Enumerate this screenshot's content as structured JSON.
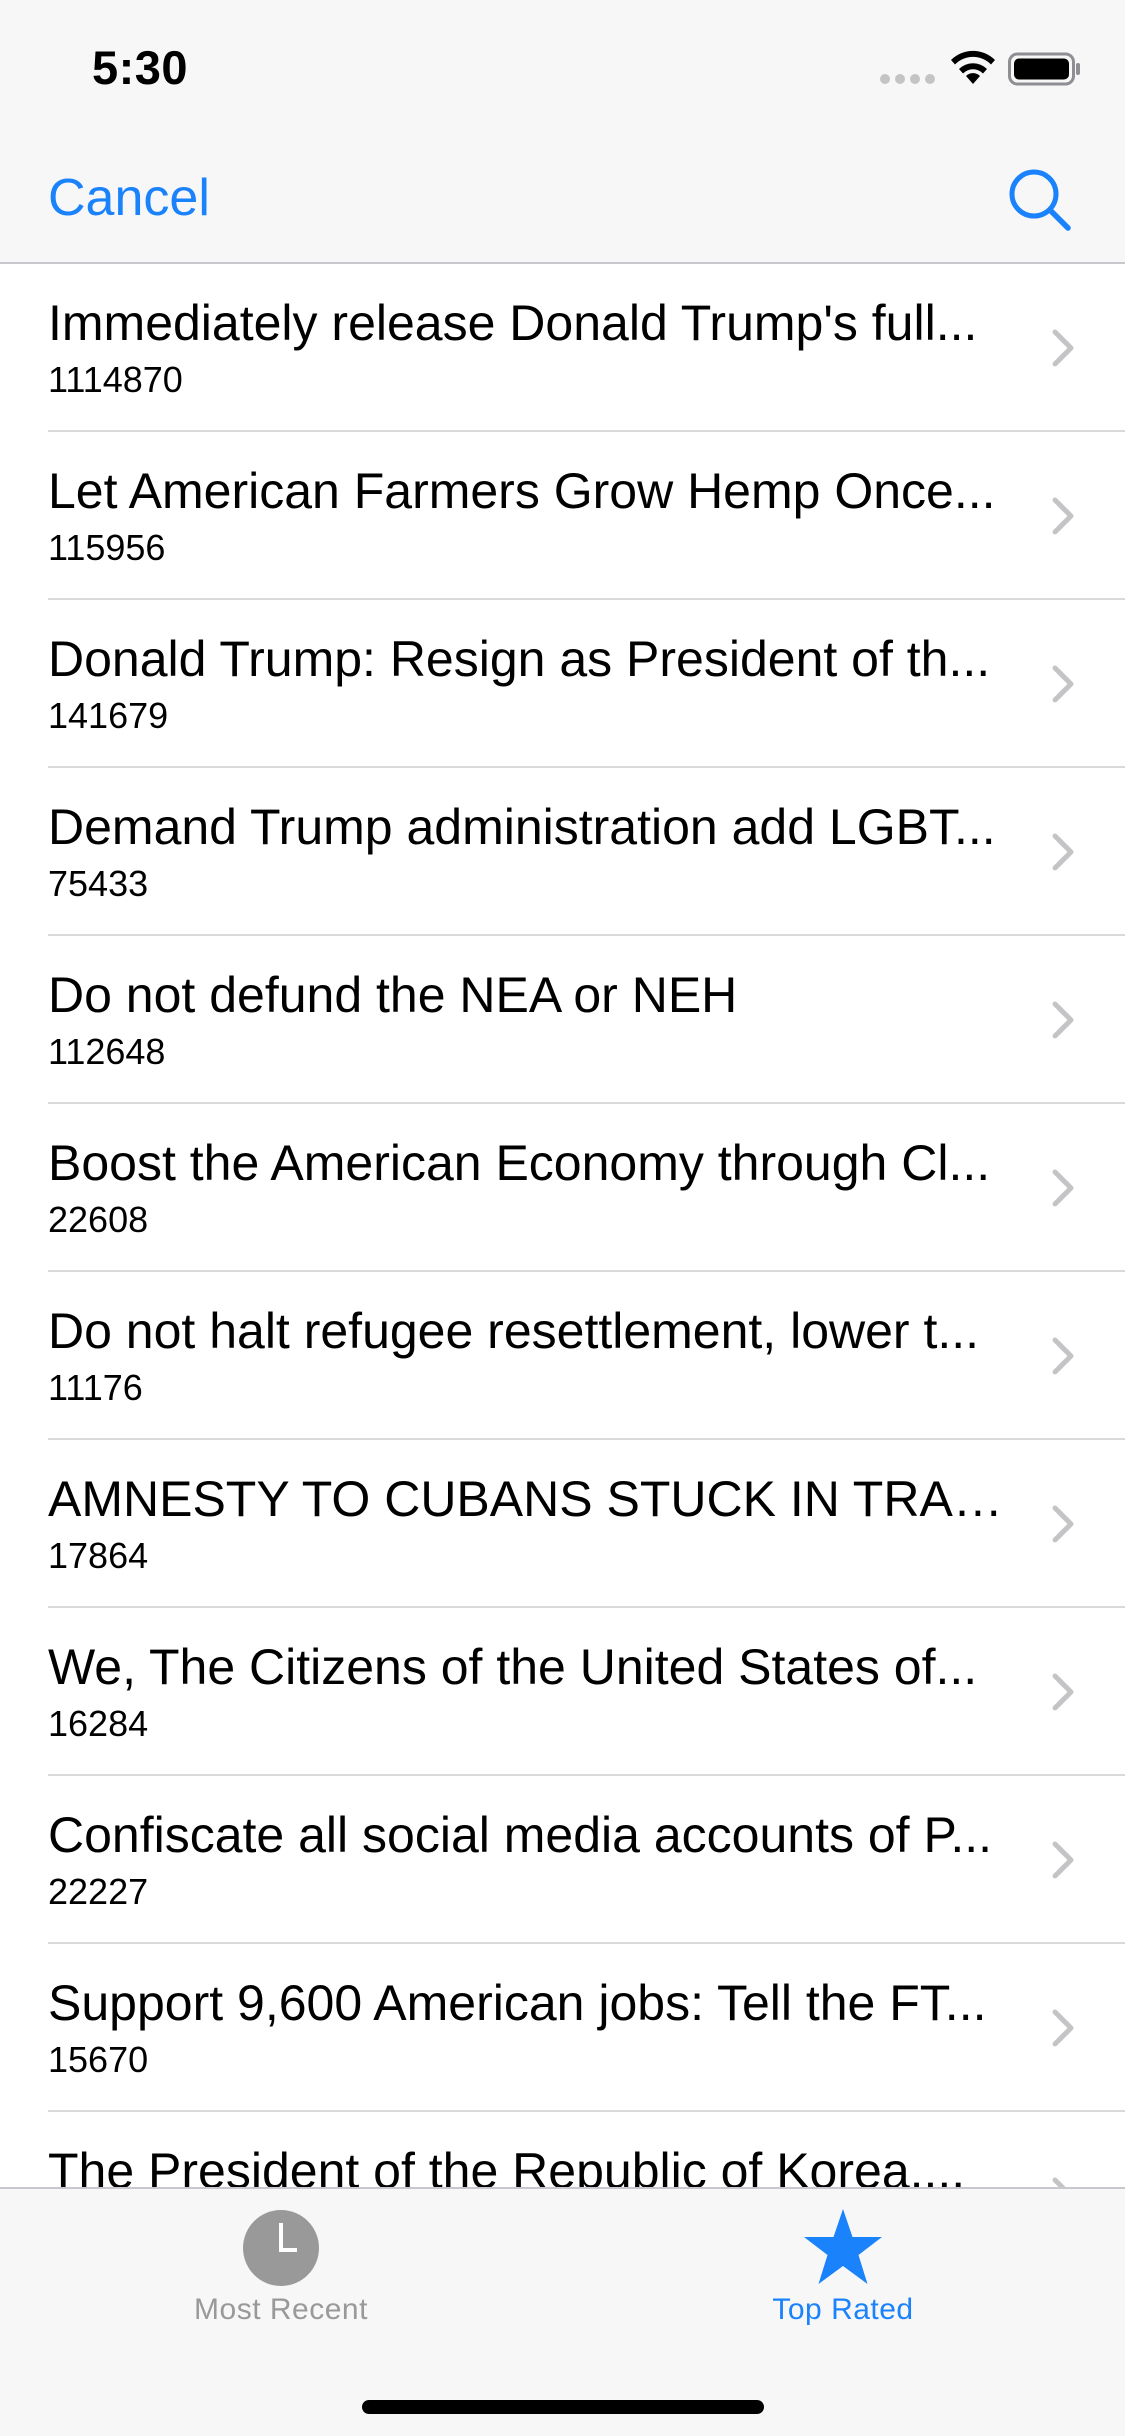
{
  "status_bar": {
    "time": "5:30"
  },
  "nav": {
    "cancel_label": "Cancel",
    "search_icon": "search-icon",
    "accent_color": "#1a82fb"
  },
  "items": [
    {
      "title": "Immediately release Donald Trump's full...",
      "count": "1114870"
    },
    {
      "title": "Let American Farmers Grow Hemp Once...",
      "count": "115956"
    },
    {
      "title": "Donald Trump:  Resign as President of th...",
      "count": "141679"
    },
    {
      "title": "Demand Trump administration add LGBT...",
      "count": "75433"
    },
    {
      "title": "Do not defund the NEA or NEH",
      "count": "112648"
    },
    {
      "title": "Boost the American Economy through Cl...",
      "count": "22608"
    },
    {
      "title": "Do not halt refugee resettlement, lower t...",
      "count": "11176"
    },
    {
      "title": "AMNESTY TO CUBANS STUCK IN TRAN...",
      "count": "17864"
    },
    {
      "title": "We, The Citizens of the United States of...",
      "count": "16284"
    },
    {
      "title": "Confiscate all social media accounts of P...",
      "count": "22227"
    },
    {
      "title": "Support 9,600 American jobs: Tell the FT...",
      "count": "15670"
    },
    {
      "title": "The President of the Republic of Korea....",
      "count": ""
    }
  ],
  "tabs": [
    {
      "label": "Most Recent",
      "icon": "clock-icon",
      "selected": false
    },
    {
      "label": "Top Rated",
      "icon": "star-icon",
      "selected": true
    }
  ]
}
